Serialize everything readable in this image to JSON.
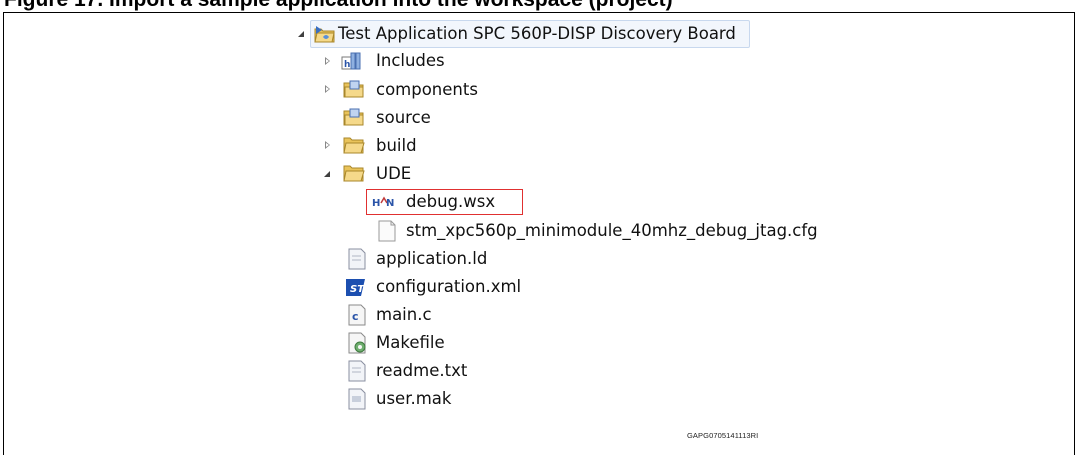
{
  "caption": "Figure 17. Import a sample application into the workspace (project)",
  "tree": {
    "root": {
      "label": "Test Application SPC 560P-DISP Discovery Board",
      "state": "expanded",
      "icon": "project-folder-icon"
    },
    "items": [
      {
        "label": "Includes",
        "state": "collapsed",
        "icon": "includes-icon"
      },
      {
        "label": "components",
        "state": "collapsed",
        "icon": "source-folder-icon"
      },
      {
        "label": "source",
        "state": "none",
        "icon": "source-folder-icon"
      },
      {
        "label": "build",
        "state": "collapsed",
        "icon": "folder-icon"
      },
      {
        "label": "UDE",
        "state": "expanded",
        "icon": "folder-icon"
      },
      {
        "label": "debug.wsx",
        "state": "none",
        "icon": "wsx-file-icon",
        "highlighted": true
      },
      {
        "label": "stm_xpc560p_minimodule_40mhz_debug_jtag.cfg",
        "state": "none",
        "icon": "file-icon"
      },
      {
        "label": "application.ld",
        "state": "none",
        "icon": "file-icon"
      },
      {
        "label": "configuration.xml",
        "state": "none",
        "icon": "st-config-icon"
      },
      {
        "label": "main.c",
        "state": "none",
        "icon": "c-file-icon"
      },
      {
        "label": "Makefile",
        "state": "none",
        "icon": "makefile-icon"
      },
      {
        "label": "readme.txt",
        "state": "none",
        "icon": "file-icon"
      },
      {
        "label": "user.mak",
        "state": "none",
        "icon": "mak-file-icon"
      }
    ]
  },
  "reference_code": "GAPG0705141113RI",
  "colors": {
    "highlight_border": "#e03030",
    "folder_yellow": "#e9c35a",
    "selection_bg": "#f2f6fc"
  }
}
